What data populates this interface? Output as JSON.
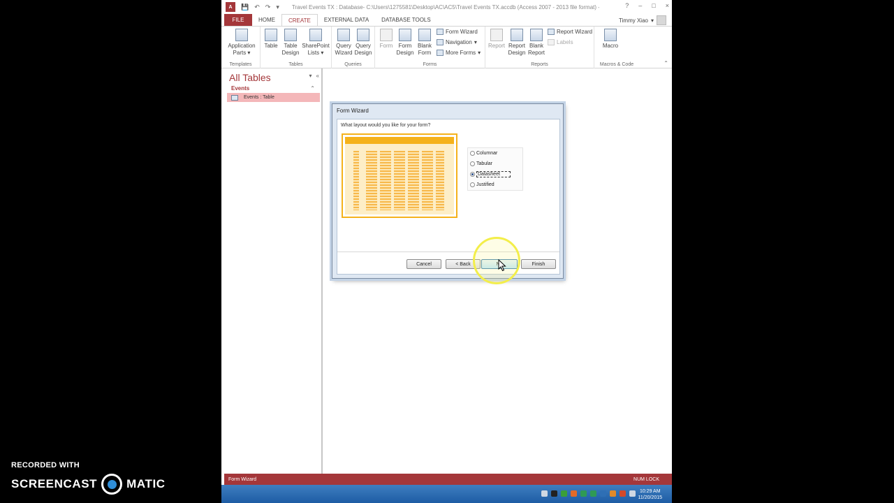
{
  "window": {
    "app_icon_label": "A",
    "qat": [
      "💾",
      "↶",
      "↷",
      "▾"
    ],
    "title": "Travel Events TX : Database- C:\\Users\\1275581\\Desktop\\AC\\AC5\\Travel Events TX.accdb (Access 2007 - 2013 file format) - A...",
    "controls": [
      "?",
      "–",
      "□",
      "×"
    ]
  },
  "tabs": [
    "FILE",
    "HOME",
    "CREATE",
    "EXTERNAL DATA",
    "DATABASE TOOLS"
  ],
  "user": {
    "name": "Timmy Xiao"
  },
  "ribbon": {
    "groups": {
      "templates": "Templates",
      "tables": "Tables",
      "queries": "Queries",
      "forms": "Forms",
      "reports": "Reports",
      "macros": "Macros & Code"
    },
    "buttons": {
      "application_parts": "Application Parts",
      "table": "Table",
      "table_design": "Table Design",
      "sharepoint_lists": "SharePoint Lists",
      "query_wizard": "Query Wizard",
      "query_design": "Query Design",
      "form": "Form",
      "form_design": "Form Design",
      "blank_form": "Blank Form",
      "form_wizard": "Form Wizard",
      "navigation": "Navigation",
      "more_forms": "More Forms",
      "report": "Report",
      "report_design": "Report Design",
      "blank_report": "Blank Report",
      "report_wizard": "Report Wizard",
      "labels": "Labels",
      "macro": "Macro"
    }
  },
  "nav": {
    "title": "All Tables",
    "group": "Events",
    "item": "Events : Table"
  },
  "dialog": {
    "title": "Form Wizard",
    "question": "What layout would you like for your form?",
    "options": [
      "Columnar",
      "Tabular",
      "Datasheet",
      "Justified"
    ],
    "selected": "Datasheet",
    "buttons": {
      "cancel": "Cancel",
      "back": "< Back",
      "next": "Next >",
      "finish": "Finish"
    },
    "next_visible": "Ne"
  },
  "status": {
    "left": "Form Wizard",
    "right": "NUM LOCK"
  },
  "taskbar": {
    "time": "10:29 AM",
    "date": "11/20/2015"
  },
  "watermark": {
    "recorded": "RECORDED WITH",
    "brand_left": "SCREENCAST",
    "brand_right": "MATIC"
  },
  "colors": {
    "access_red": "#a4373a",
    "preview_orange": "#f5b21b",
    "highlight_yellow": "#f3ee4a"
  }
}
